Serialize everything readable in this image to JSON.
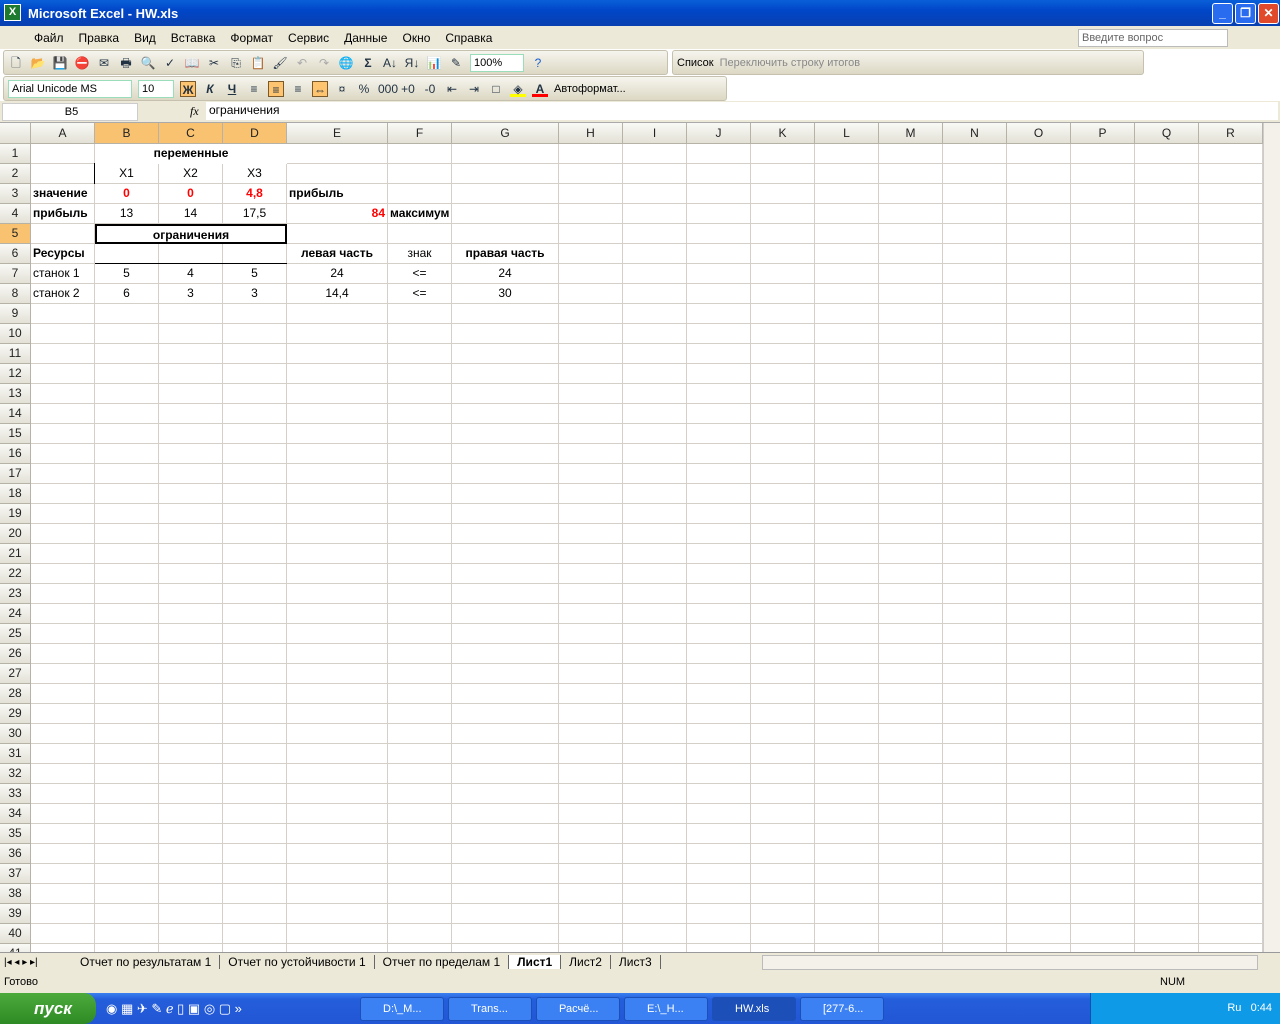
{
  "window": {
    "title": "Microsoft Excel - HW.xls"
  },
  "menu": [
    "Файл",
    "Правка",
    "Вид",
    "Вставка",
    "Формат",
    "Сервис",
    "Данные",
    "Окно",
    "Справка"
  ],
  "help_placeholder": "Введите вопрос",
  "toolbar": {
    "zoom": "100%",
    "list_label": "Список",
    "toggle_totals": "Переключить строку итогов"
  },
  "format": {
    "font": "Arial Unicode MS",
    "size": "10",
    "bold": "Ж",
    "italic": "К",
    "underline": "Ч",
    "percent": "%",
    "thousands": "000",
    "autoformat": "Автоформат..."
  },
  "formula_bar": {
    "name_box": "B5",
    "fx": "fx",
    "content": "ограничения"
  },
  "columns": [
    "A",
    "B",
    "C",
    "D",
    "E",
    "F",
    "G",
    "H",
    "I",
    "J",
    "K",
    "L",
    "M",
    "N",
    "O",
    "P",
    "Q",
    "R"
  ],
  "selected_cols": [
    "B",
    "C",
    "D"
  ],
  "selected_row": 5,
  "cells": [
    {
      "r": 1,
      "c": "B",
      "span": 3,
      "v": "переменные",
      "b": true,
      "al": "center"
    },
    {
      "r": 2,
      "c": "B",
      "v": "X1",
      "al": "center"
    },
    {
      "r": 2,
      "c": "C",
      "v": "X2",
      "al": "center"
    },
    {
      "r": 2,
      "c": "D",
      "v": "X3",
      "al": "center"
    },
    {
      "r": 3,
      "c": "A",
      "v": "значение",
      "b": true
    },
    {
      "r": 3,
      "c": "B",
      "v": "0",
      "b": true,
      "red": true,
      "al": "center"
    },
    {
      "r": 3,
      "c": "C",
      "v": "0",
      "b": true,
      "red": true,
      "al": "center"
    },
    {
      "r": 3,
      "c": "D",
      "v": "4,8",
      "b": true,
      "red": true,
      "al": "center"
    },
    {
      "r": 3,
      "c": "E",
      "v": "прибыль",
      "b": true
    },
    {
      "r": 4,
      "c": "A",
      "v": "прибыль",
      "b": true
    },
    {
      "r": 4,
      "c": "B",
      "v": "13",
      "al": "center"
    },
    {
      "r": 4,
      "c": "C",
      "v": "14",
      "al": "center"
    },
    {
      "r": 4,
      "c": "D",
      "v": "17,5",
      "al": "center"
    },
    {
      "r": 4,
      "c": "E",
      "v": "84",
      "b": true,
      "red": true,
      "al": "right"
    },
    {
      "r": 4,
      "c": "F",
      "v": "максимум",
      "b": true
    },
    {
      "r": 5,
      "c": "B",
      "span": 3,
      "v": "ограничения",
      "b": true,
      "al": "center"
    },
    {
      "r": 6,
      "c": "A",
      "v": "Ресурсы",
      "b": true
    },
    {
      "r": 6,
      "c": "E",
      "v": "левая часть",
      "b": true,
      "al": "center"
    },
    {
      "r": 6,
      "c": "F",
      "v": "знак",
      "al": "center"
    },
    {
      "r": 6,
      "c": "G",
      "v": "правая часть",
      "b": true,
      "al": "center"
    },
    {
      "r": 7,
      "c": "A",
      "v": "станок 1"
    },
    {
      "r": 7,
      "c": "B",
      "v": "5",
      "al": "center"
    },
    {
      "r": 7,
      "c": "C",
      "v": "4",
      "al": "center"
    },
    {
      "r": 7,
      "c": "D",
      "v": "5",
      "al": "center"
    },
    {
      "r": 7,
      "c": "E",
      "v": "24",
      "al": "center"
    },
    {
      "r": 7,
      "c": "F",
      "v": "<=",
      "al": "center"
    },
    {
      "r": 7,
      "c": "G",
      "v": "24",
      "al": "center"
    },
    {
      "r": 8,
      "c": "A",
      "v": "станок 2"
    },
    {
      "r": 8,
      "c": "B",
      "v": "6",
      "al": "center"
    },
    {
      "r": 8,
      "c": "C",
      "v": "3",
      "al": "center"
    },
    {
      "r": 8,
      "c": "D",
      "v": "3",
      "al": "center"
    },
    {
      "r": 8,
      "c": "E",
      "v": "14,4",
      "al": "center"
    },
    {
      "r": 8,
      "c": "F",
      "v": "<=",
      "al": "center"
    },
    {
      "r": 8,
      "c": "G",
      "v": "30",
      "al": "center"
    }
  ],
  "sheet_tabs": [
    "Отчет по результатам 1",
    "Отчет по устойчивости 1",
    "Отчет по пределам 1",
    "Лист1",
    "Лист2",
    "Лист3"
  ],
  "active_tab": "Лист1",
  "status": {
    "ready": "Готово",
    "num": "NUM"
  },
  "taskbar": {
    "start": "пуск",
    "tasks": [
      "D:\\_M...",
      "Trans...",
      "Расчё...",
      "E:\\_H...",
      "HW.xls",
      "[277-6..."
    ],
    "active": "HW.xls",
    "lang": "Ru",
    "clock": "0:44"
  }
}
